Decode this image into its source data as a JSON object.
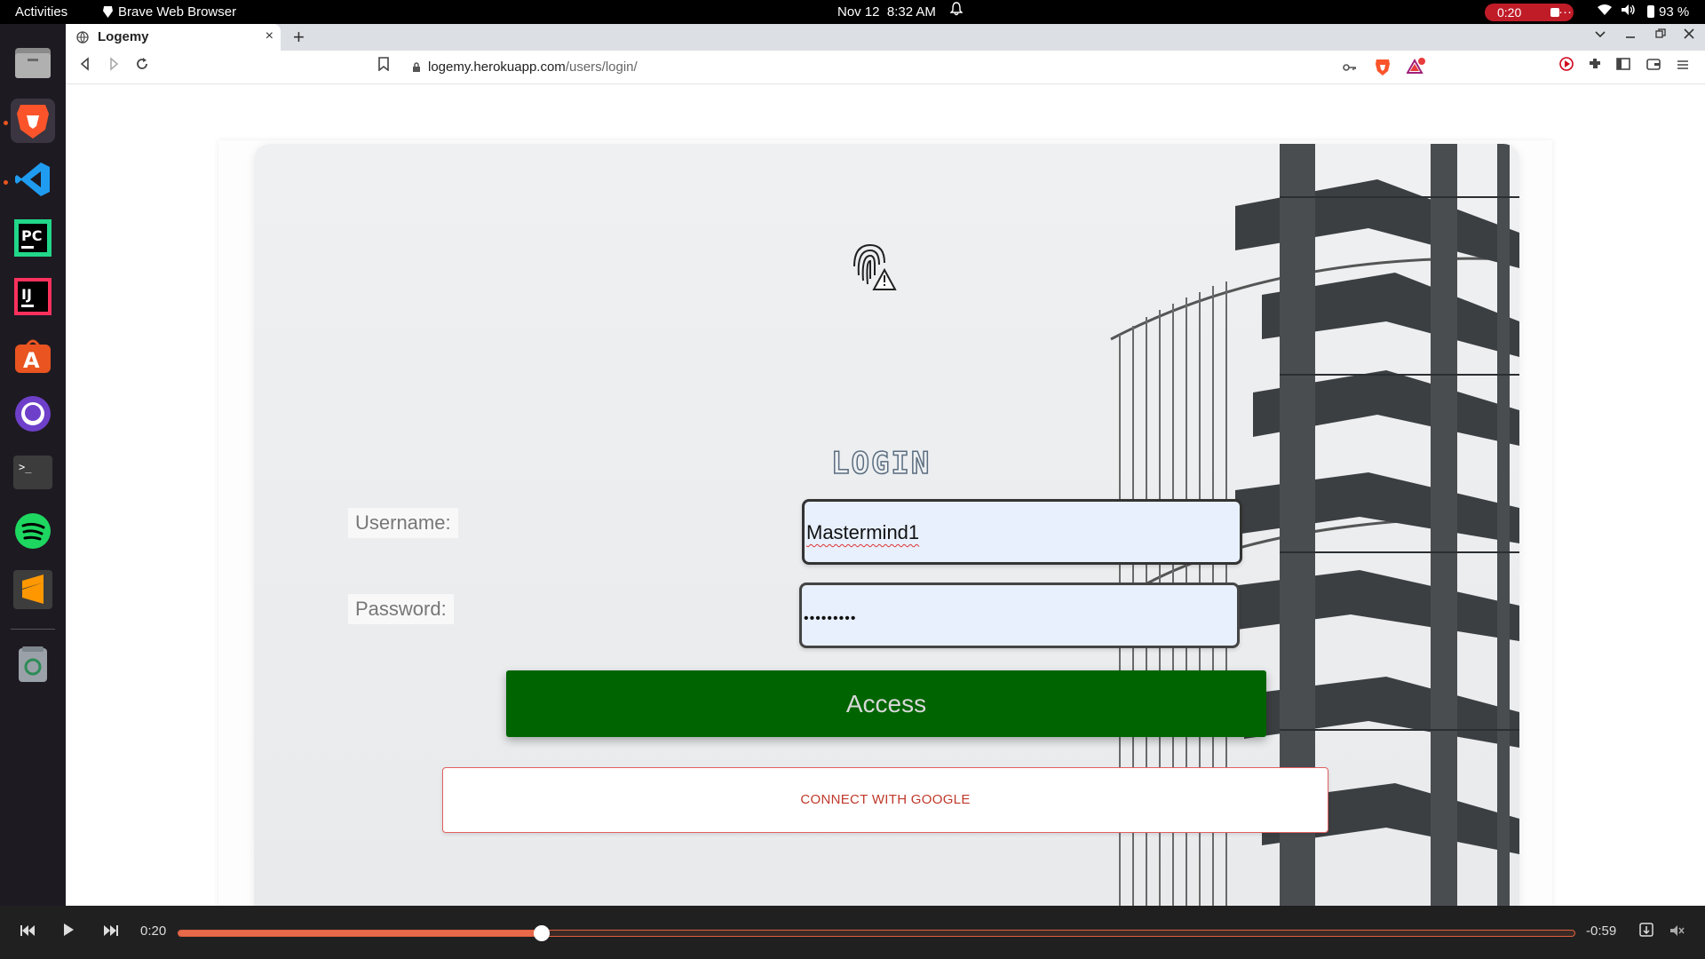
{
  "topbar": {
    "activities": "Activities",
    "app_name": "Brave Web Browser",
    "date": "Nov 12",
    "time": "8:32 AM",
    "recording": "0:20",
    "more": "···",
    "battery": "93 %"
  },
  "browser": {
    "tab_title": "Logemy",
    "tab_close": "×",
    "new_tab": "+",
    "url_host": "logemy.herokuapp.com",
    "url_path": "/users/login/"
  },
  "login": {
    "title": "LOGIN",
    "username_label": "Username:",
    "username_value": "Mastermind1",
    "password_label": "Password:",
    "password_value": "•••••••••",
    "access_label": "Access",
    "google_label": "CONNECT WITH GOOGLE"
  },
  "player": {
    "elapsed": "0:20",
    "remaining": "-0:59",
    "progress": 0.26
  },
  "colors": {
    "access_green": "#006400",
    "google_red": "#c0392b",
    "record_red": "#c01c28",
    "progress_orange": "#e86a4a"
  }
}
